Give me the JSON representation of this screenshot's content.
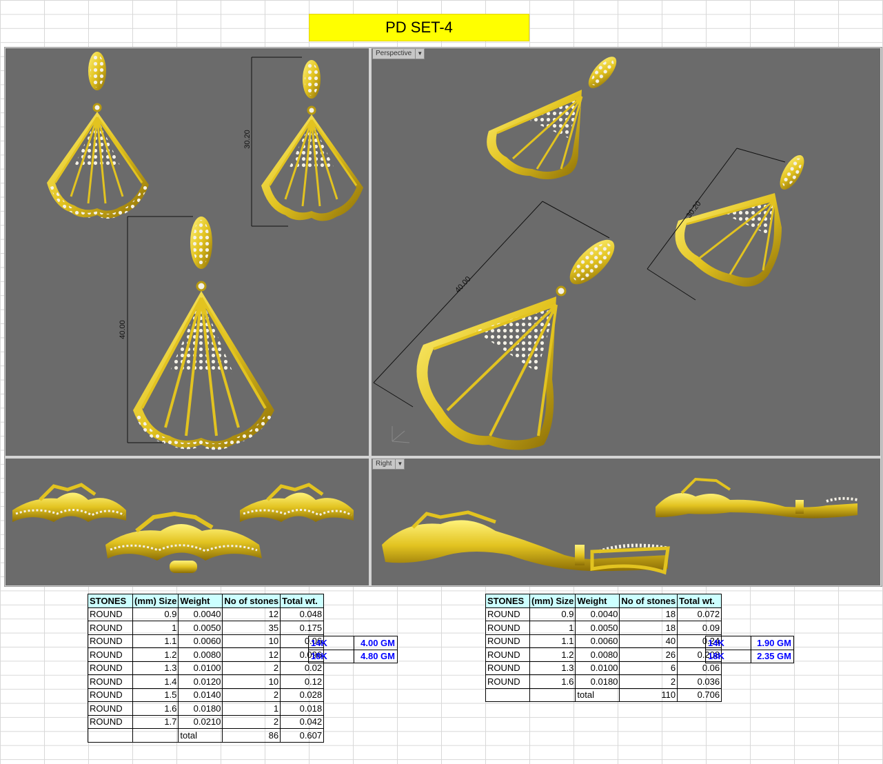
{
  "title": "PD SET-4",
  "colors": {
    "title_bg": "#ffff00",
    "viewport_bg": "#6b6b6b",
    "gold": "#e2c320",
    "header_bg": "#ccffff",
    "karat_text": "#0000ff"
  },
  "viewports": {
    "top": {
      "dim_small": "30.20",
      "dim_large": "40.00"
    },
    "perspective": {
      "label": "Perspective",
      "dim_small": "30.20",
      "dim_large": "40.00"
    },
    "front": {},
    "right": {
      "label": "Right"
    }
  },
  "table_left": {
    "headers": [
      "STONES",
      "(mm) Size",
      "Weight",
      "No of stones",
      "Total wt."
    ],
    "rows": [
      [
        "ROUND",
        "0.9",
        "0.0040",
        "12",
        "0.048"
      ],
      [
        "ROUND",
        "1",
        "0.0050",
        "35",
        "0.175"
      ],
      [
        "ROUND",
        "1.1",
        "0.0060",
        "10",
        "0.06"
      ],
      [
        "ROUND",
        "1.2",
        "0.0080",
        "12",
        "0.096"
      ],
      [
        "ROUND",
        "1.3",
        "0.0100",
        "2",
        "0.02"
      ],
      [
        "ROUND",
        "1.4",
        "0.0120",
        "10",
        "0.12"
      ],
      [
        "ROUND",
        "1.5",
        "0.0140",
        "2",
        "0.028"
      ],
      [
        "ROUND",
        "1.6",
        "0.0180",
        "1",
        "0.018"
      ],
      [
        "ROUND",
        "1.7",
        "0.0210",
        "2",
        "0.042"
      ]
    ],
    "total_label": "total",
    "total_count": "86",
    "total_wt": "0.607",
    "karat": [
      [
        "14K",
        "4.00 GM"
      ],
      [
        "18K",
        "4.80 GM"
      ]
    ]
  },
  "table_right": {
    "headers": [
      "STONES",
      "(mm) Size",
      "Weight",
      "No of stones",
      "Total wt."
    ],
    "rows": [
      [
        "ROUND",
        "0.9",
        "0.0040",
        "18",
        "0.072"
      ],
      [
        "ROUND",
        "1",
        "0.0050",
        "18",
        "0.09"
      ],
      [
        "ROUND",
        "1.1",
        "0.0060",
        "40",
        "0.24"
      ],
      [
        "ROUND",
        "1.2",
        "0.0080",
        "26",
        "0.208"
      ],
      [
        "ROUND",
        "1.3",
        "0.0100",
        "6",
        "0.06"
      ],
      [
        "ROUND",
        "1.6",
        "0.0180",
        "2",
        "0.036"
      ]
    ],
    "total_label": "total",
    "total_count": "110",
    "total_wt": "0.706",
    "karat": [
      [
        "14K",
        "1.90 GM"
      ],
      [
        "18K",
        "2.35 GM"
      ]
    ]
  }
}
